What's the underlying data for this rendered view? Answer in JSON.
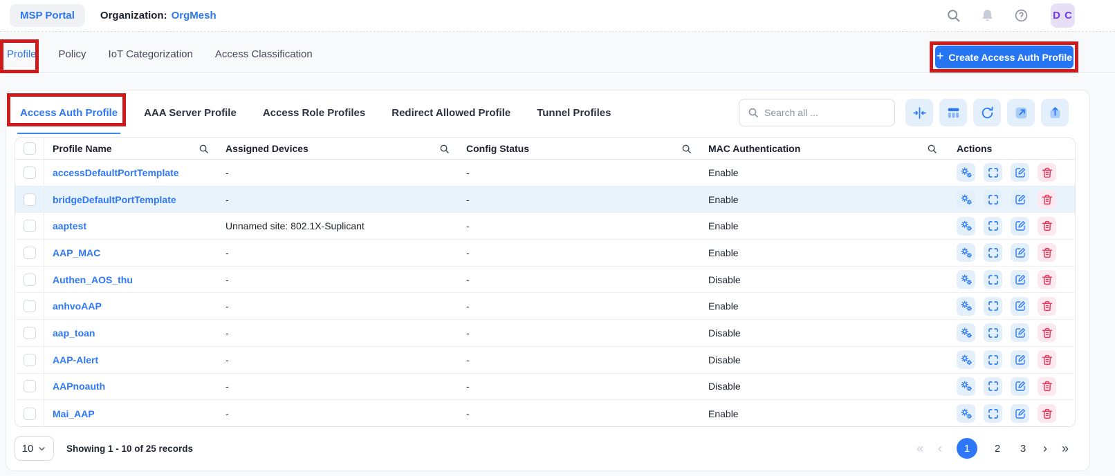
{
  "header": {
    "brand": "MSP Portal",
    "org_label": "Organization:",
    "org_value": "OrgMesh",
    "avatar_initials": "D C"
  },
  "tabs": {
    "items": [
      {
        "label": "Profile",
        "active": true
      },
      {
        "label": "Policy",
        "active": false
      },
      {
        "label": "IoT Categorization",
        "active": false
      },
      {
        "label": "Access Classification",
        "active": false
      }
    ]
  },
  "create_button": {
    "plus": "+",
    "label": "Create Access Auth Profile"
  },
  "subtabs": {
    "items": [
      "Access Auth Profile",
      "AAA Server Profile",
      "Access Role Profiles",
      "Redirect Allowed Profile",
      "Tunnel Profiles"
    ],
    "active": "Access Auth Profile"
  },
  "toolbar": {
    "search_placeholder": "Search all ...",
    "icons": [
      "collapse-columns",
      "manage-columns",
      "refresh",
      "open-external",
      "upload"
    ]
  },
  "table": {
    "columns": [
      "Profile Name",
      "Assigned Devices",
      "Config Status",
      "MAC Authentication",
      "Actions"
    ],
    "rows": [
      {
        "name": "accessDefaultPortTemplate",
        "devices": "-",
        "config": "-",
        "mac": "Enable",
        "highlighted": false
      },
      {
        "name": "bridgeDefaultPortTemplate",
        "devices": "-",
        "config": "-",
        "mac": "Enable",
        "highlighted": true
      },
      {
        "name": "aaptest",
        "devices": "Unnamed site: 802.1X-Suplicant",
        "config": "-",
        "mac": "Enable",
        "highlighted": false
      },
      {
        "name": "AAP_MAC",
        "devices": "-",
        "config": "-",
        "mac": "Enable",
        "highlighted": false
      },
      {
        "name": "Authen_AOS_thu",
        "devices": "-",
        "config": "-",
        "mac": "Disable",
        "highlighted": false
      },
      {
        "name": "anhvoAAP",
        "devices": "-",
        "config": "-",
        "mac": "Enable",
        "highlighted": false
      },
      {
        "name": "aap_toan",
        "devices": "-",
        "config": "-",
        "mac": "Disable",
        "highlighted": false
      },
      {
        "name": "AAP-Alert",
        "devices": "-",
        "config": "-",
        "mac": "Disable",
        "highlighted": false
      },
      {
        "name": "AAPnoauth",
        "devices": "-",
        "config": "-",
        "mac": "Disable",
        "highlighted": false
      },
      {
        "name": "Mai_AAP",
        "devices": "-",
        "config": "-",
        "mac": "Enable",
        "highlighted": false
      }
    ]
  },
  "pagination": {
    "page_size": "10",
    "summary": "Showing 1 - 10 of 25 records",
    "first": "«",
    "prev": "‹",
    "pages": [
      "1",
      "2",
      "3"
    ],
    "current_page": "1",
    "next": "›",
    "last": "»"
  },
  "colors": {
    "accent_blue": "#2e77f6",
    "button_blue": "#2676f3",
    "annotation_red": "#cd1a1a",
    "delete_red": "#e83a5f",
    "row_highlight": "#e9f3fc"
  }
}
